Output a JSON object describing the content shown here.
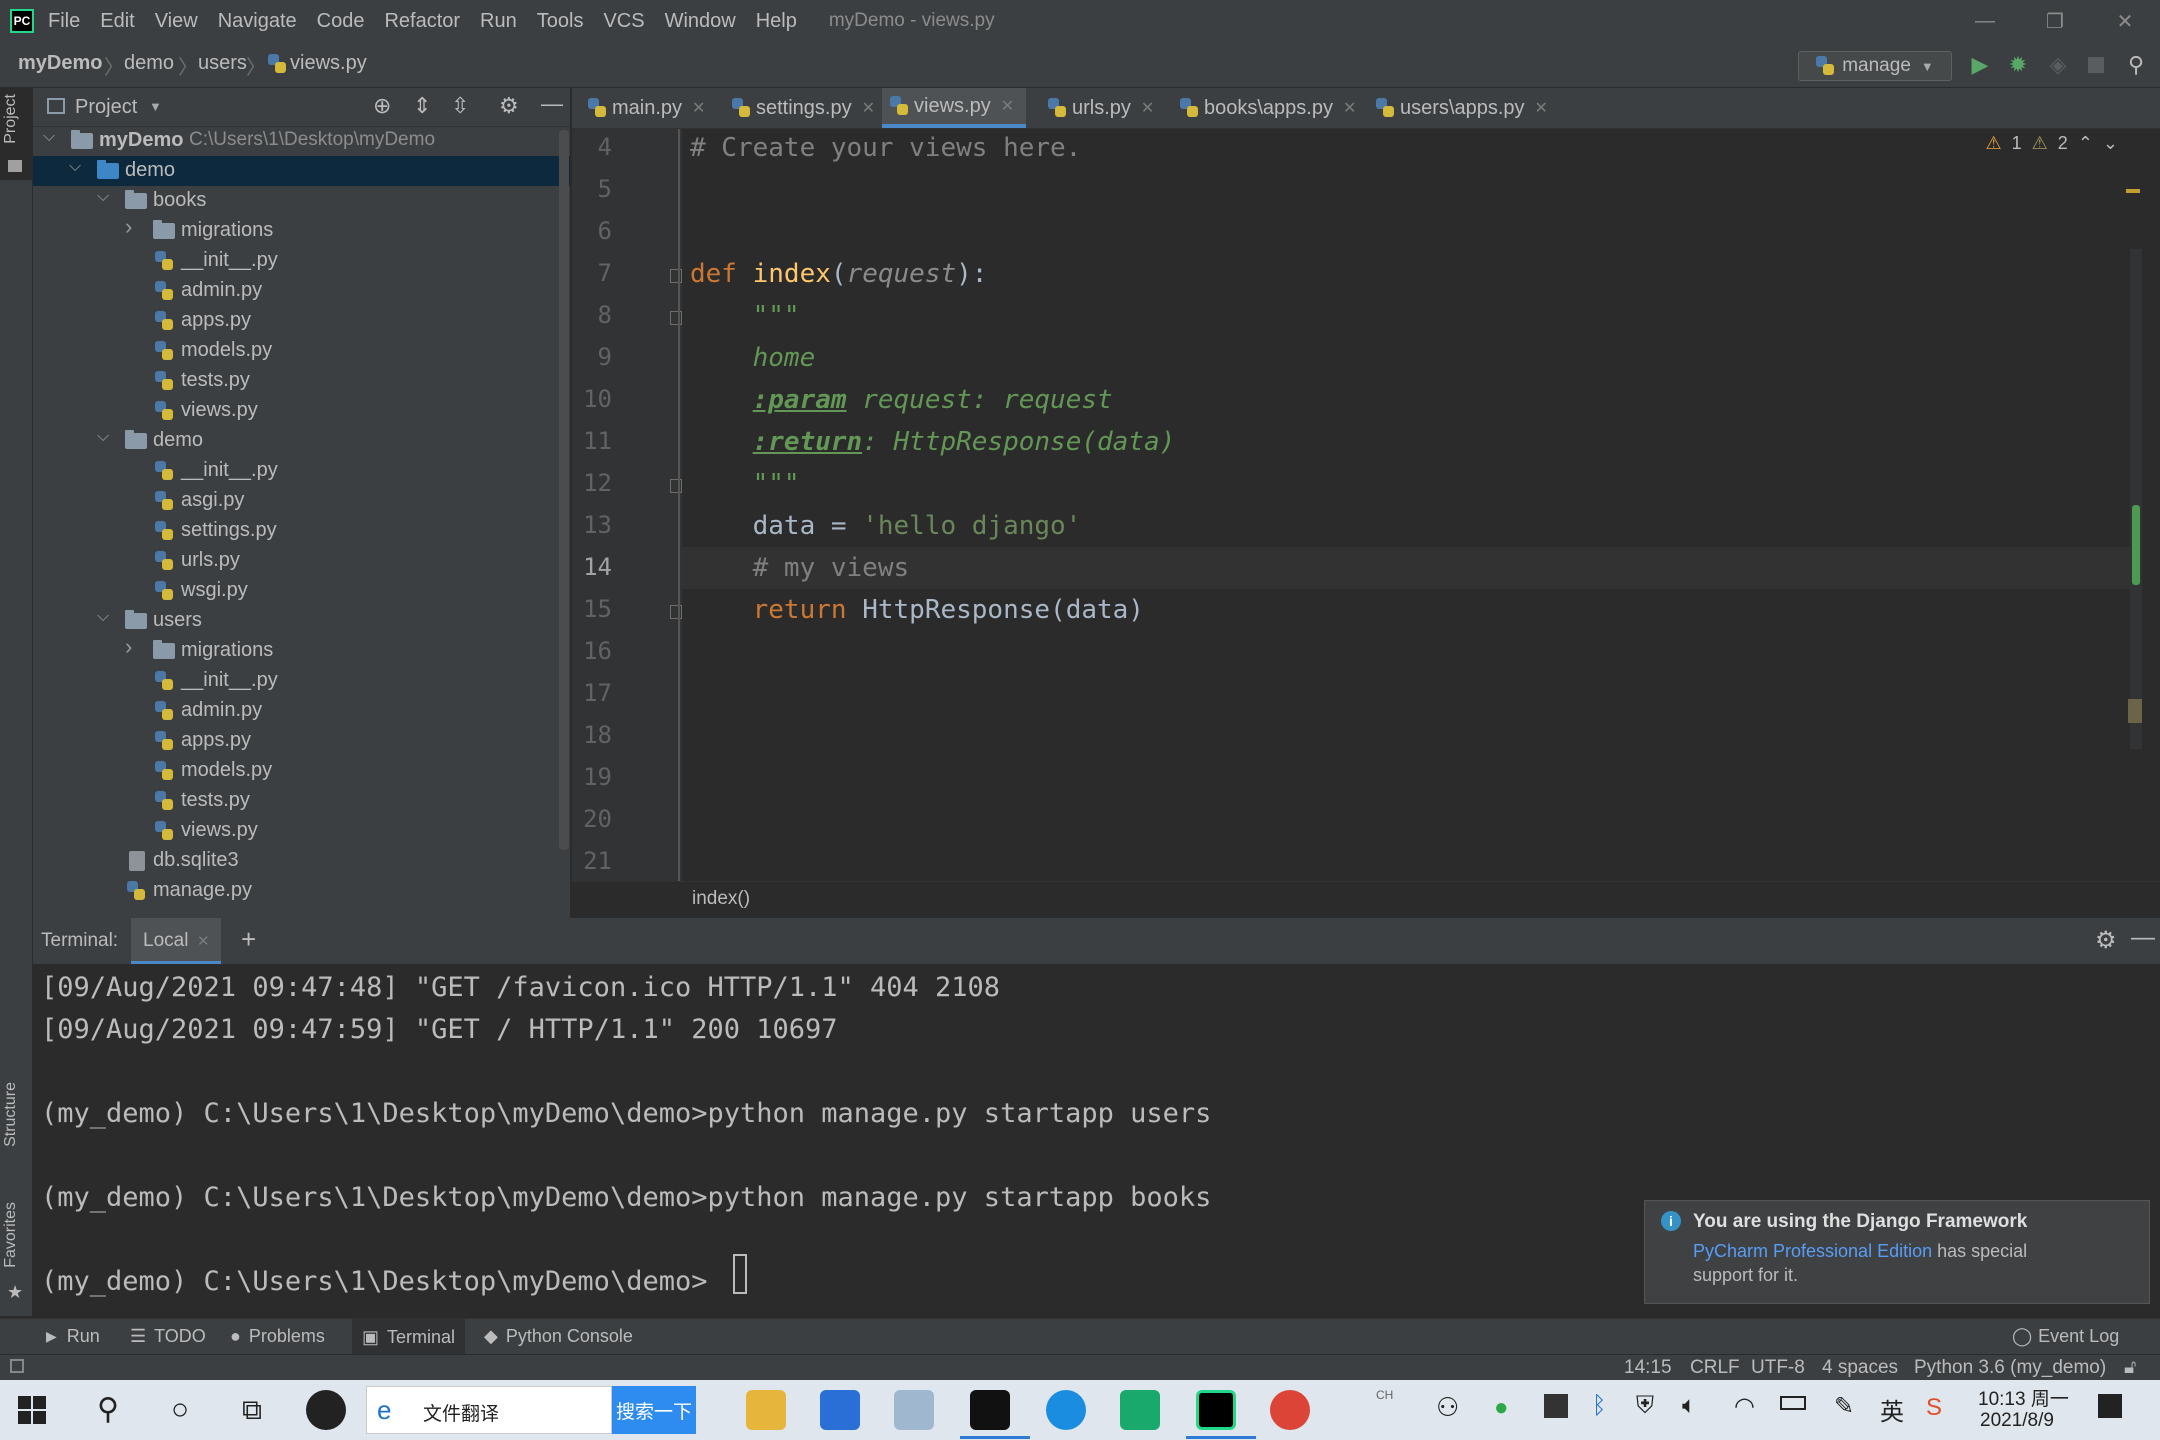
{
  "app": {
    "menu": [
      "File",
      "Edit",
      "View",
      "Navigate",
      "Code",
      "Refactor",
      "Run",
      "Tools",
      "VCS",
      "Window",
      "Help"
    ],
    "window_title": "myDemo - views.py"
  },
  "breadcrumb": [
    "myDemo",
    "demo",
    "users",
    "views.py"
  ],
  "run_config": "manage",
  "project_panel": {
    "title": "Project",
    "root_name": "myDemo",
    "root_path": "C:\\Users\\1\\Desktop\\myDemo",
    "tree": [
      {
        "label": "demo",
        "kind": "folder-blue",
        "depth": 1,
        "expanded": true,
        "selected": true
      },
      {
        "label": "books",
        "kind": "folder",
        "depth": 2,
        "expanded": true
      },
      {
        "label": "migrations",
        "kind": "folder",
        "depth": 3,
        "expanded": false
      },
      {
        "label": "__init__.py",
        "kind": "py",
        "depth": 3
      },
      {
        "label": "admin.py",
        "kind": "py",
        "depth": 3
      },
      {
        "label": "apps.py",
        "kind": "py",
        "depth": 3
      },
      {
        "label": "models.py",
        "kind": "py",
        "depth": 3
      },
      {
        "label": "tests.py",
        "kind": "py",
        "depth": 3
      },
      {
        "label": "views.py",
        "kind": "py",
        "depth": 3
      },
      {
        "label": "demo",
        "kind": "folder",
        "depth": 2,
        "expanded": true
      },
      {
        "label": "__init__.py",
        "kind": "py",
        "depth": 3
      },
      {
        "label": "asgi.py",
        "kind": "py",
        "depth": 3
      },
      {
        "label": "settings.py",
        "kind": "py",
        "depth": 3
      },
      {
        "label": "urls.py",
        "kind": "py",
        "depth": 3
      },
      {
        "label": "wsgi.py",
        "kind": "py",
        "depth": 3
      },
      {
        "label": "users",
        "kind": "folder",
        "depth": 2,
        "expanded": true
      },
      {
        "label": "migrations",
        "kind": "folder",
        "depth": 3,
        "expanded": false
      },
      {
        "label": "__init__.py",
        "kind": "py",
        "depth": 3
      },
      {
        "label": "admin.py",
        "kind": "py",
        "depth": 3
      },
      {
        "label": "apps.py",
        "kind": "py",
        "depth": 3
      },
      {
        "label": "models.py",
        "kind": "py",
        "depth": 3
      },
      {
        "label": "tests.py",
        "kind": "py",
        "depth": 3
      },
      {
        "label": "views.py",
        "kind": "py",
        "depth": 3
      },
      {
        "label": "db.sqlite3",
        "kind": "db",
        "depth": 2
      },
      {
        "label": "manage.py",
        "kind": "py",
        "depth": 2
      }
    ]
  },
  "editor_tabs": [
    {
      "label": "main.py",
      "active": false
    },
    {
      "label": "settings.py",
      "active": false
    },
    {
      "label": "views.py",
      "active": true
    },
    {
      "label": "urls.py",
      "active": false
    },
    {
      "label": "books\\apps.py",
      "active": false
    },
    {
      "label": "users\\apps.py",
      "active": false
    }
  ],
  "inspections": {
    "warnings": "1",
    "weak_warnings": "2"
  },
  "code": {
    "current_line": 14,
    "lines": [
      {
        "n": 4,
        "tokens": [
          {
            "t": "# Create your views here.",
            "c": "comment"
          }
        ]
      },
      {
        "n": 5,
        "tokens": []
      },
      {
        "n": 6,
        "tokens": []
      },
      {
        "n": 7,
        "tokens": [
          {
            "t": "def ",
            "c": "kw"
          },
          {
            "t": "index",
            "c": "fn"
          },
          {
            "t": "(",
            "c": "plain"
          },
          {
            "t": "request",
            "c": "param"
          },
          {
            "t": "):",
            "c": "plain"
          }
        ]
      },
      {
        "n": 8,
        "tokens": [
          {
            "t": "    \"\"\"",
            "c": "doc"
          }
        ]
      },
      {
        "n": 9,
        "tokens": [
          {
            "t": "    home",
            "c": "doc"
          }
        ]
      },
      {
        "n": 10,
        "tokens": [
          {
            "t": "    ",
            "c": "doc"
          },
          {
            "t": ":param",
            "c": "doctag"
          },
          {
            "t": " request: request",
            "c": "doc"
          }
        ]
      },
      {
        "n": 11,
        "tokens": [
          {
            "t": "    ",
            "c": "doc"
          },
          {
            "t": ":return",
            "c": "doctag"
          },
          {
            "t": ": HttpResponse(data)",
            "c": "doc"
          }
        ]
      },
      {
        "n": 12,
        "tokens": [
          {
            "t": "    \"\"\"",
            "c": "doc"
          }
        ]
      },
      {
        "n": 13,
        "tokens": [
          {
            "t": "    data = ",
            "c": "plain"
          },
          {
            "t": "'hello django'",
            "c": "str"
          }
        ]
      },
      {
        "n": 14,
        "tokens": [
          {
            "t": "    # my views",
            "c": "comment"
          }
        ]
      },
      {
        "n": 15,
        "tokens": [
          {
            "t": "    ",
            "c": "plain"
          },
          {
            "t": "return ",
            "c": "kw"
          },
          {
            "t": "HttpResponse(data)",
            "c": "plain"
          }
        ]
      },
      {
        "n": 16,
        "tokens": []
      },
      {
        "n": 17,
        "tokens": []
      },
      {
        "n": 18,
        "tokens": []
      },
      {
        "n": 19,
        "tokens": []
      },
      {
        "n": 20,
        "tokens": []
      },
      {
        "n": 21,
        "tokens": []
      }
    ]
  },
  "editor_breadcrumb": "index()",
  "terminal": {
    "title": "Terminal:",
    "tab": "Local",
    "lines": [
      "[09/Aug/2021 09:47:48] \"GET /favicon.ico HTTP/1.1\" 404 2108",
      "[09/Aug/2021 09:47:59] \"GET / HTTP/1.1\" 200 10697",
      "",
      "(my_demo) C:\\Users\\1\\Desktop\\myDemo\\demo>python manage.py startapp users",
      "",
      "(my_demo) C:\\Users\\1\\Desktop\\myDemo\\demo>python manage.py startapp books",
      "",
      "(my_demo) C:\\Users\\1\\Desktop\\myDemo\\demo>"
    ]
  },
  "side_tabs": {
    "project": "Project",
    "structure": "Structure",
    "favorites": "Favorites"
  },
  "notification": {
    "title": "You are using the Django Framework",
    "link": "PyCharm Professional Edition",
    "text1": " has special",
    "text2": "support for it."
  },
  "bottom_tools": [
    "Run",
    "TODO",
    "Problems",
    "Terminal",
    "Python Console"
  ],
  "event_log": "Event Log",
  "status": {
    "position": "14:15",
    "line_sep": "CRLF",
    "encoding": "UTF-8",
    "indent": "4 spaces",
    "interpreter": "Python 3.6 (my_demo)"
  },
  "taskbar": {
    "search_text": "文件翻译",
    "search_button": "搜索一下",
    "ime": "英",
    "ch_label": "CH",
    "time": "10:13 周一",
    "date": "2021/8/9"
  },
  "colors": {
    "comment": "#808080",
    "kw": "#cc7832",
    "fn": "#ffc66d",
    "param": "#8a8a8a",
    "doc": "#629755",
    "doctag": "#629755",
    "str": "#6a8759",
    "plain": "#a9b7c6"
  }
}
